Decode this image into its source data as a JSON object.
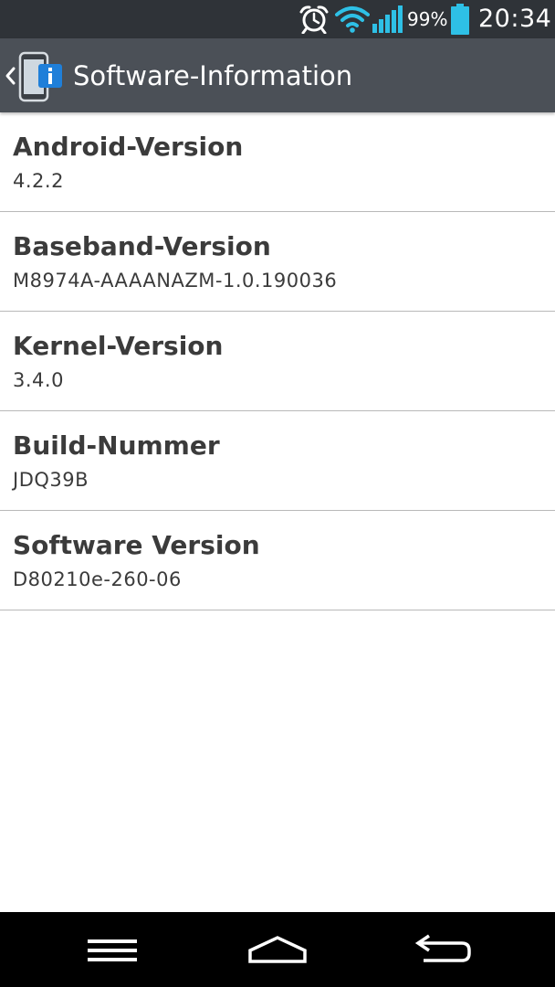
{
  "status_bar": {
    "battery_percent": "99%",
    "time": "20:34",
    "icons": [
      "alarm-icon",
      "wifi-icon",
      "signal-icon",
      "battery-icon"
    ],
    "colors": {
      "wifi": "#2ec0e6",
      "signal": "#2ec0e6",
      "battery": "#2ec0e6"
    }
  },
  "action_bar": {
    "title": "Software-Information",
    "icons": [
      "back-chevron-icon",
      "phone-info-icon"
    ]
  },
  "items": [
    {
      "label": "Android-Version",
      "value": "4.2.2"
    },
    {
      "label": "Baseband-Version",
      "value": "M8974A-AAAANAZM-1.0.190036"
    },
    {
      "label": "Kernel-Version",
      "value": "3.4.0"
    },
    {
      "label": "Build-Nummer",
      "value": "JDQ39B"
    },
    {
      "label": "Software Version",
      "value": "D80210e-260-06"
    }
  ],
  "nav_bar": {
    "icons": [
      "menu-icon",
      "home-icon",
      "back-icon"
    ]
  }
}
